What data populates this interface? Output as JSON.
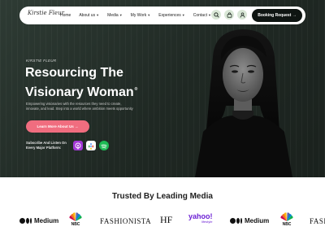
{
  "nav": {
    "logo": "Kirstie Fleur",
    "links": [
      {
        "label": "Home",
        "dropdown": false
      },
      {
        "label": "About us",
        "dropdown": true
      },
      {
        "label": "Media",
        "dropdown": true
      },
      {
        "label": "My Work",
        "dropdown": true
      },
      {
        "label": "Experiences",
        "dropdown": true
      },
      {
        "label": "Contact",
        "dropdown": true
      }
    ],
    "icons": [
      "search-icon",
      "bag-icon",
      "user-icon"
    ],
    "booking_button": "Booking Request →"
  },
  "hero": {
    "eyebrow": "KIRSTIE FLEUR",
    "headline_line1": "Resourcing The",
    "headline_line2": "Visionary Woman",
    "headline_mark": "®",
    "lede_line1": "Empowering visionaries with the resources they need to create,",
    "lede_line2": "innovate, and lead. Step into a world where ambition meets opportunity",
    "cta": "Learn More About Us →",
    "subscribe_line1": "Subscribe And Listen On",
    "subscribe_line2": "Every Major Platform:",
    "platforms": [
      "apple-podcasts-icon",
      "google-podcasts-icon",
      "spotify-icon"
    ],
    "colors": {
      "hero_bg": "#1f2823",
      "cta": "#f06d7f",
      "nav_accent": "#d9e7d6",
      "booking": "#0f1512"
    }
  },
  "trusted": {
    "title": "Trusted By Leading Media",
    "logos": {
      "medium": "Medium",
      "nbc": "NBC",
      "fashionista": "FASHIONISTA",
      "hf": "HF",
      "yahoo": "yahoo!",
      "yahoo_sub": "lifestyle"
    }
  }
}
